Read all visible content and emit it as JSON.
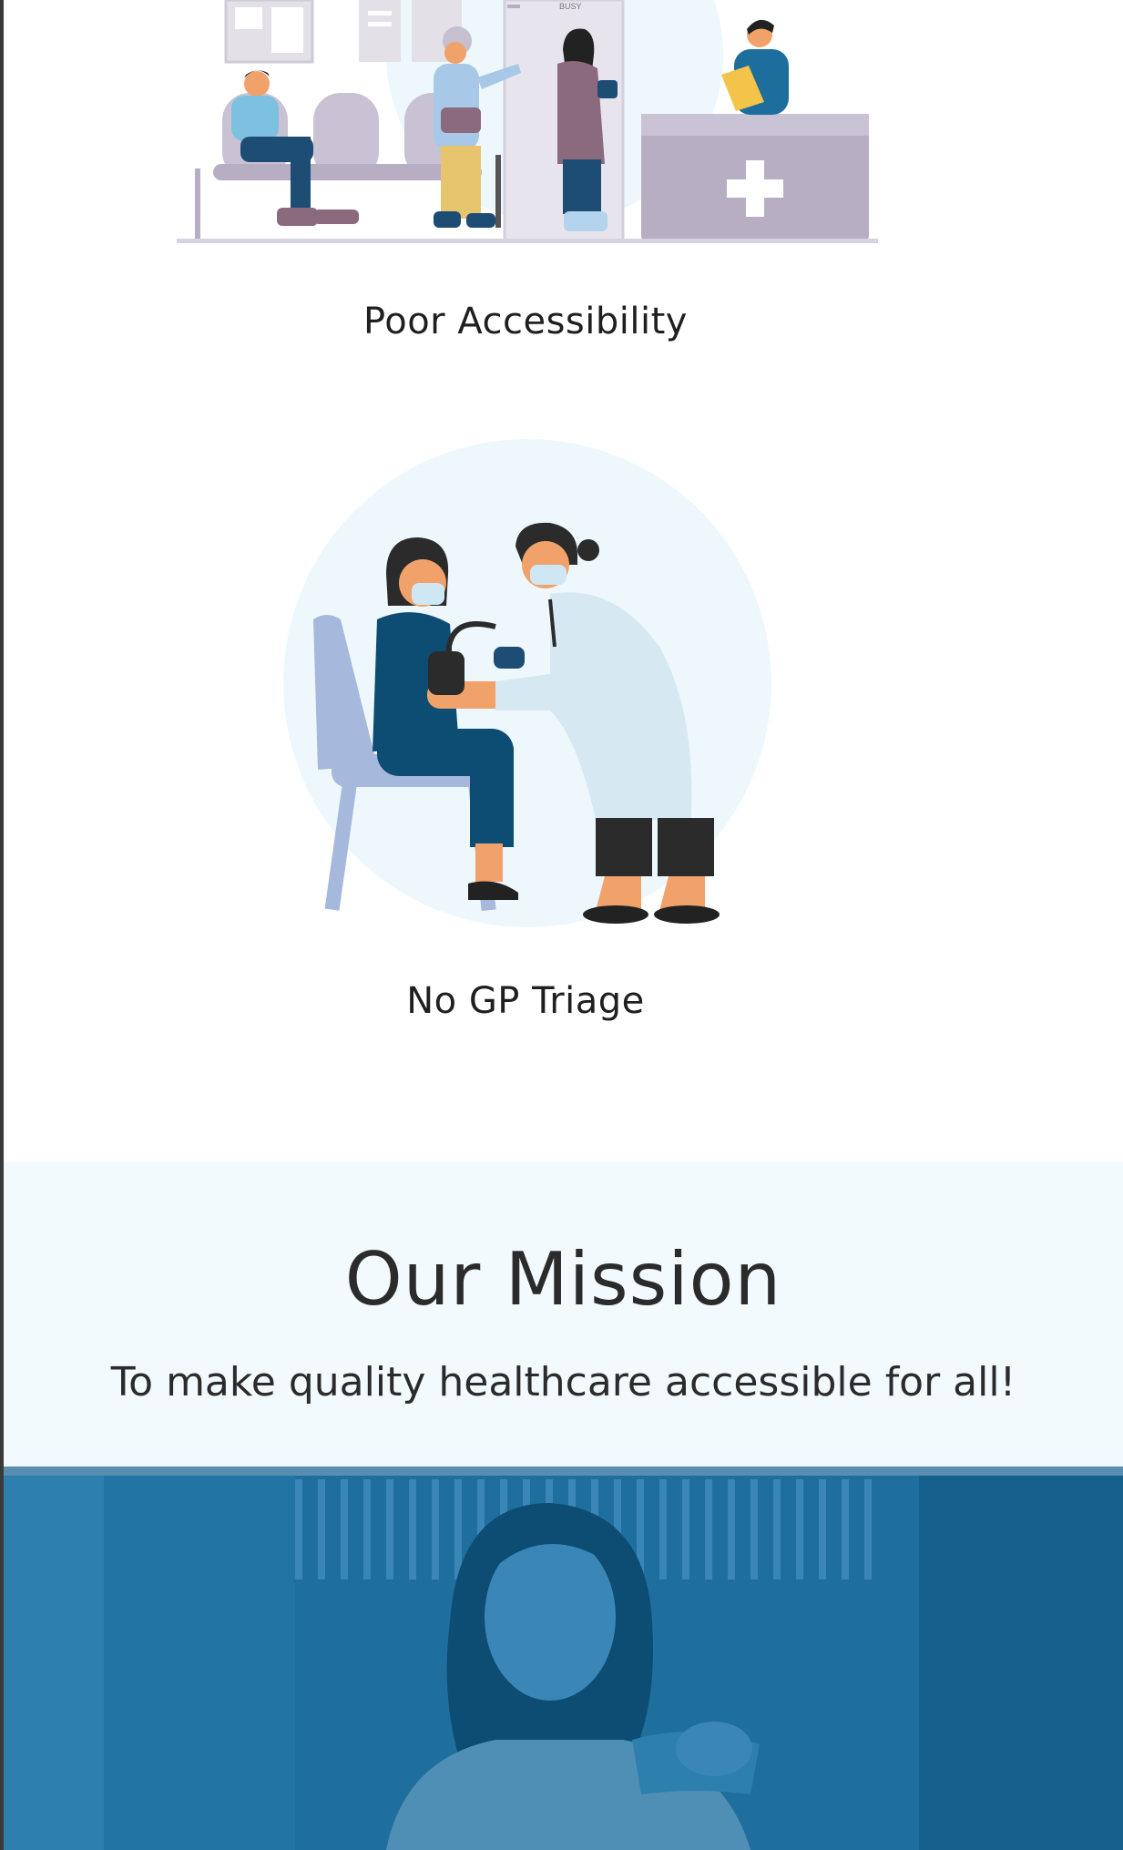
{
  "problems": [
    {
      "label": "Poor Accessibility",
      "illustration": "waiting-room-illustration"
    },
    {
      "label": "No GP Triage",
      "illustration": "doctor-checkup-illustration"
    }
  ],
  "mission": {
    "heading": "Our Mission",
    "statement": "To make quality healthcare accessible for all!"
  },
  "hero": {
    "image": "smiling-woman-photo"
  },
  "colors": {
    "mission_bg": "#f2fafd",
    "hero_blue": "#1f6f9e",
    "navy": "#0e4d73",
    "lavender": "#b7aec4",
    "light_blue_circle": "#eef8fc"
  }
}
